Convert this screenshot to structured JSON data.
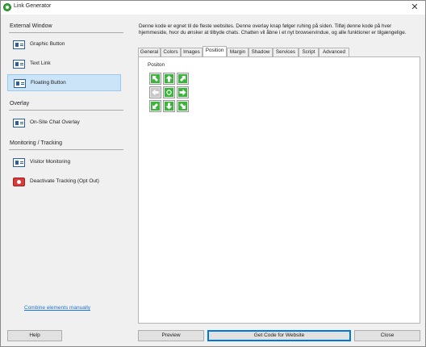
{
  "window": {
    "title": "Link Generator"
  },
  "sidebar": {
    "sections": [
      {
        "title": "External Window",
        "items": [
          {
            "label": "Graphic Button"
          },
          {
            "label": "Text Link"
          },
          {
            "label": "Floating Button"
          }
        ]
      },
      {
        "title": "Overlay",
        "items": [
          {
            "label": "On-Site Chat Overlay"
          }
        ]
      },
      {
        "title": "Monitoring / Tracking",
        "items": [
          {
            "label": "Visitor Monitoring"
          },
          {
            "label": "Deactivate Tracking (Opt Out)"
          }
        ]
      }
    ],
    "active_item": "Floating Button",
    "combine_link": "Combine elements manually"
  },
  "description": "Denne kode er egnet til de fleste websites. Denne overlay knap følger ruhing på siden. Tilføj denne kode på hver hjemmeside, hvor du ønsker at tilbyde chats. Chatten vil åbne i et nyt browservindue, og alle funktioner er tilgængelige.",
  "tabs": {
    "items": [
      "General",
      "Colors",
      "Images",
      "Position",
      "Margin",
      "Shadow",
      "Services",
      "Script",
      "Advanced"
    ],
    "active": "Position"
  },
  "position_panel": {
    "group_label": "Positon",
    "grid": [
      {
        "name": "top-left",
        "icon": "arrow-up-left-icon",
        "enabled": true
      },
      {
        "name": "top-center",
        "icon": "arrow-up-icon",
        "enabled": true
      },
      {
        "name": "top-right",
        "icon": "arrow-up-right-icon",
        "enabled": true
      },
      {
        "name": "middle-left",
        "icon": "arrow-left-icon",
        "enabled": false
      },
      {
        "name": "center",
        "icon": "circle-icon",
        "enabled": true
      },
      {
        "name": "middle-right",
        "icon": "arrow-right-icon",
        "enabled": true
      },
      {
        "name": "bottom-left",
        "icon": "arrow-down-left-icon",
        "enabled": true
      },
      {
        "name": "bottom-center",
        "icon": "arrow-down-icon",
        "enabled": true
      },
      {
        "name": "bottom-right",
        "icon": "arrow-down-right-icon",
        "enabled": true
      }
    ]
  },
  "buttons": {
    "help": "Help",
    "preview": "Preview",
    "get_code": "Get Code for Website",
    "close": "Close"
  },
  "colors": {
    "accent": "#0078d7",
    "selection": "#cce4f7",
    "arrow_green": "#3cb43c",
    "link": "#1a73d9"
  }
}
